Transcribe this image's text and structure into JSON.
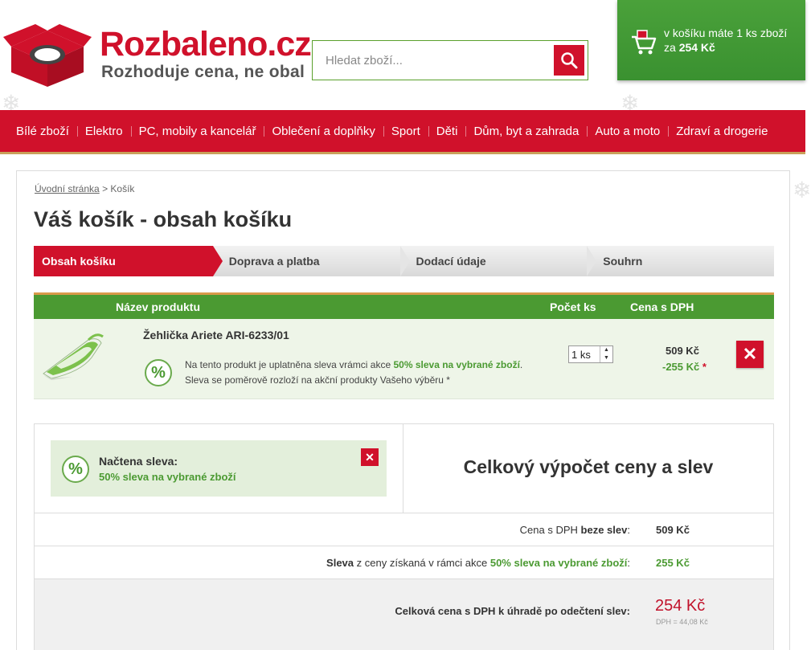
{
  "brand": {
    "name": "Rozbaleno.cz",
    "tagline": "Rozhoduje cena, ne obal"
  },
  "search": {
    "placeholder": "Hledat zboží...",
    "value": ""
  },
  "cart": {
    "line1": "v košíku máte 1 ks zboží",
    "line2_prefix": "za",
    "total": "254 Kč"
  },
  "nav": {
    "items": [
      "Bílé zboží",
      "Elektro",
      "PC, mobily a kancelář",
      "Oblečení a doplňky",
      "Sport",
      "Děti",
      "Dům, byt a zahrada",
      "Auto a moto",
      "Zdraví a drogerie"
    ]
  },
  "breadcrumb": {
    "home": "Úvodní stránka",
    "separator": ">",
    "current": "Košík"
  },
  "page": {
    "title": "Váš košík - obsah košíku"
  },
  "steps": [
    "Obsah košíku",
    "Doprava a platba",
    "Dodací údaje",
    "Souhrn"
  ],
  "table": {
    "headers": {
      "name": "Název produktu",
      "qty": "Počet ks",
      "price": "Cena s DPH"
    },
    "items": [
      {
        "name": "Žehlička Ariete ARI-6233/01",
        "note_prefix": "Na tento produkt je uplatněna sleva vrámci akce",
        "note_promo": "50% sleva na vybrané zboží",
        "note_suffix": ".",
        "note_line2": "Sleva se poměrově rozloží na akční produkty Vašeho výběru *",
        "qty": "1 ks",
        "price": "509 Kč",
        "discount": "-255 Kč",
        "discount_mark": "*"
      }
    ]
  },
  "badge": {
    "symbol": "%"
  },
  "coupon": {
    "title": "Načtena sleva:",
    "name": "50% sleva na vybrané zboží"
  },
  "summary": {
    "title": "Celkový výpočet ceny a slev",
    "row1": {
      "label_prefix": "Cena s DPH",
      "label_bold": "beze slev",
      "label_suffix": ":",
      "value": "509 Kč"
    },
    "row2": {
      "label_bold": "Sleva",
      "label_mid": "z ceny získaná v rámci akce",
      "label_promo": "50% sleva na vybrané zboží",
      "label_suffix": ":",
      "value": "255 Kč"
    },
    "total": {
      "label": "Celková cena s DPH k úhradě po odečtení slev:",
      "value": "254 Kč",
      "vat": "DPH = 44,08 Kč"
    }
  },
  "colors": {
    "brand_red": "#d0112b",
    "green": "#4b9a32",
    "gold": "#c9a05a"
  }
}
